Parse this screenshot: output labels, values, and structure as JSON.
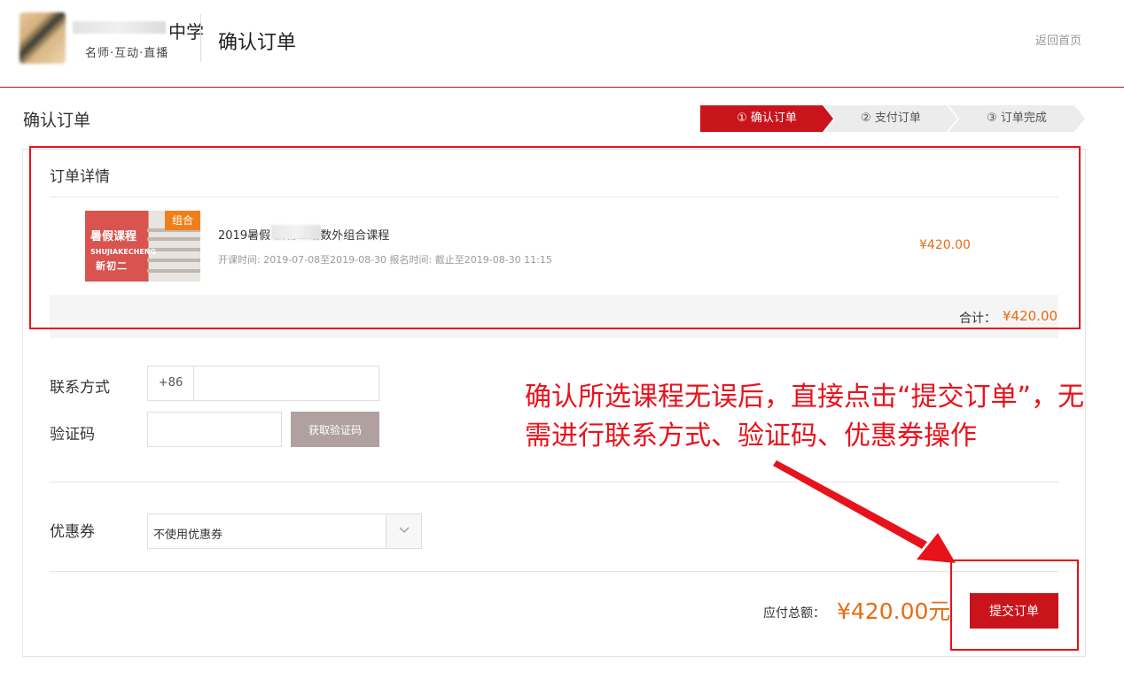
{
  "header": {
    "school_suffix": "中学",
    "school_sub": "名师·互动·直播",
    "title": "确认订单",
    "back_home": "返回首页"
  },
  "page_title": "确认订单",
  "steps": [
    {
      "label": "① 确认订单"
    },
    {
      "label": "② 支付订单"
    },
    {
      "label": "③ 订单完成"
    }
  ],
  "order": {
    "section_title": "订单详情",
    "course": {
      "thumb_title": "暑假课程",
      "thumb_pinyin": "SHUJIAKECHENG",
      "thumb_grade": "新初二",
      "badge": "组合",
      "name": "2019暑假             新初二语数外组合课程",
      "meta": "开课时间: 2019-07-08至2019-08-30    报名时间: 截止至2019-08-30 11:15",
      "price": "¥420.00"
    },
    "total_label": "合计：",
    "total_price": "¥420.00"
  },
  "contact": {
    "label": "联系方式",
    "country_code": "+86",
    "phone_value": "",
    "code_label": "验证码",
    "code_value": "",
    "code_button": "获取验证码"
  },
  "coupon": {
    "label": "优惠券",
    "selected": "不使用优惠券"
  },
  "payment": {
    "label": "应付总额：",
    "amount": "¥420.00元",
    "submit": "提交订单"
  },
  "annotation": "确认所选课程无误后，直接点击“提交订单”，无需进行联系方式、验证码、优惠券操作",
  "colors": {
    "brand_red": "#c9141c",
    "price_orange": "#e86b13",
    "annotation_red": "#e8121b"
  }
}
